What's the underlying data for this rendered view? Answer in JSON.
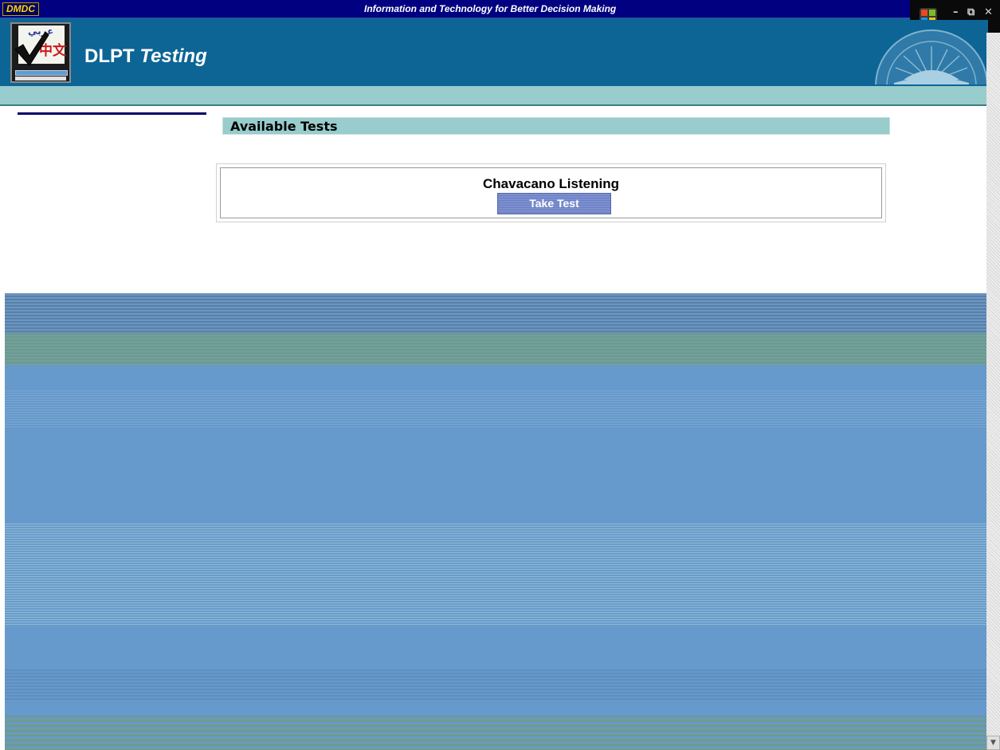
{
  "browser": {
    "brand": "DMDC",
    "tagline": "Information and Technology for Better Decision Making"
  },
  "window_controls": {
    "minimize": "–",
    "restore": "⧉",
    "close": "✕"
  },
  "header": {
    "app_name": "DLPT",
    "app_name_suffix": "Testing",
    "logo_arabic": "عربي",
    "logo_chinese": "中文"
  },
  "section": {
    "title": "Available Tests"
  },
  "tests": [
    {
      "name": "Chavacano Listening",
      "action_label": "Take Test"
    }
  ],
  "colors": {
    "topbar": "#000080",
    "banner": "#0d6596",
    "strip": "#99cccc",
    "lower_area": "#6699cc",
    "button": "#7d8fcf"
  },
  "icons": {
    "logo": "checkmark-language-icon",
    "seal": "department-of-defense-seal-icon",
    "start": "windows-flag-icon"
  }
}
